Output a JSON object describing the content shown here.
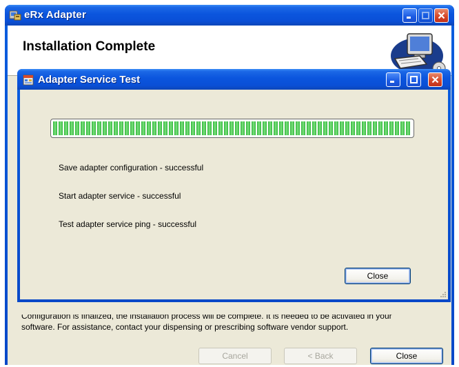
{
  "outer_window": {
    "title": "eRx Adapter",
    "header_title": "Installation Complete",
    "body_line1": "Configuration is finalized, the installation process will be complete. It is needed to be activated in your",
    "body_line2": "software. For assistance, contact your dispensing or prescribing software vendor support.",
    "buttons": {
      "cancel": "Cancel",
      "back": "< Back",
      "close": "Close"
    }
  },
  "dialog": {
    "title": "Adapter Service Test",
    "progress_fraction": 1.0,
    "status_lines": [
      "Save adapter configuration - successful",
      "Start adapter service - successful",
      "Test adapter service ping - successful"
    ],
    "close_label": "Close"
  },
  "colors": {
    "title_bar": "#0a55dd",
    "client_bg": "#ece9d8",
    "progress_green": "#2fb43a",
    "close_red": "#d7492a"
  },
  "icons": [
    "app-icon",
    "minimize-icon",
    "maximize-icon",
    "close-icon",
    "computer-icon"
  ]
}
